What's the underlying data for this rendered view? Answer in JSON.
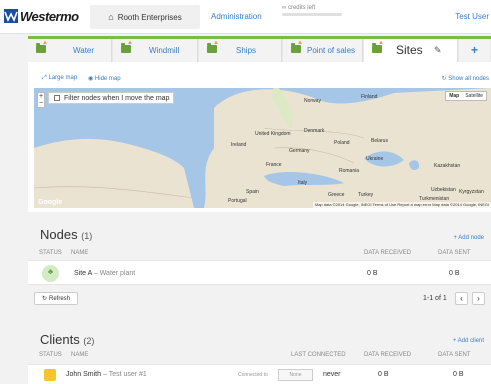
{
  "header": {
    "logo_text": "Westermo",
    "company_tab": "Rooth Enterprises",
    "admin_link": "Administration",
    "credits": "∞ credits left",
    "user": "Test User"
  },
  "site_tabs": {
    "items": [
      {
        "label": "Water"
      },
      {
        "label": "Windmill"
      },
      {
        "label": "Ships"
      },
      {
        "label": "Point of sales"
      },
      {
        "label": "Sites",
        "active": true
      }
    ],
    "add_symbol": "+"
  },
  "map": {
    "large_map": "Large map",
    "hide_map": "Hide map",
    "show_all_nodes": "Show all nodes",
    "filter_label": "Filter nodes when I move the map",
    "type_map": "Map",
    "type_satellite": "Satellite",
    "attribution": "Map data ©2014 Google, INEGI   Terms of Use   Report a map error   Map data ©2014 Google, INEGI",
    "google": "Google",
    "places": [
      "Norway",
      "Finland",
      "United Kingdom",
      "Ireland",
      "Denmark",
      "Poland",
      "Belarus",
      "Germany",
      "Ukraine",
      "France",
      "Romania",
      "Italy",
      "Spain",
      "Portugal",
      "Greece",
      "Turkey",
      "Kazakhstan",
      "Uzbekistan",
      "Kyrgyzstan",
      "Turkmenistan"
    ]
  },
  "nodes": {
    "title": "Nodes",
    "count": "(1)",
    "add_label": "+ Add node",
    "columns": {
      "status": "STATUS",
      "name": "NAME",
      "received": "DATA RECEIVED",
      "sent": "DATA SENT"
    },
    "rows": [
      {
        "name": "Site A",
        "subtitle": "– Water plant",
        "received": "0 B",
        "sent": "0 B"
      }
    ],
    "refresh": "Refresh",
    "pager": "1-1 of 1",
    "prev": "‹",
    "next": "›"
  },
  "clients": {
    "title": "Clients",
    "count": "(2)",
    "add_label": "+ Add client",
    "columns": {
      "status": "STATUS",
      "name": "NAME",
      "last_connected": "LAST CONNECTED",
      "received": "DATA RECEIVED",
      "sent": "DATA SENT"
    },
    "rows": [
      {
        "name": "John Smith",
        "subtitle": "– Test user #1",
        "connected_to": "Connected to",
        "connected_box": "None",
        "last_connected": "never",
        "received": "0 B",
        "sent": "0 B"
      }
    ]
  },
  "colors": {
    "accent": "#3b7dc4",
    "site_green": "#7cbb44",
    "folder_green": "#6aa13e",
    "warning": "#f0a020"
  }
}
